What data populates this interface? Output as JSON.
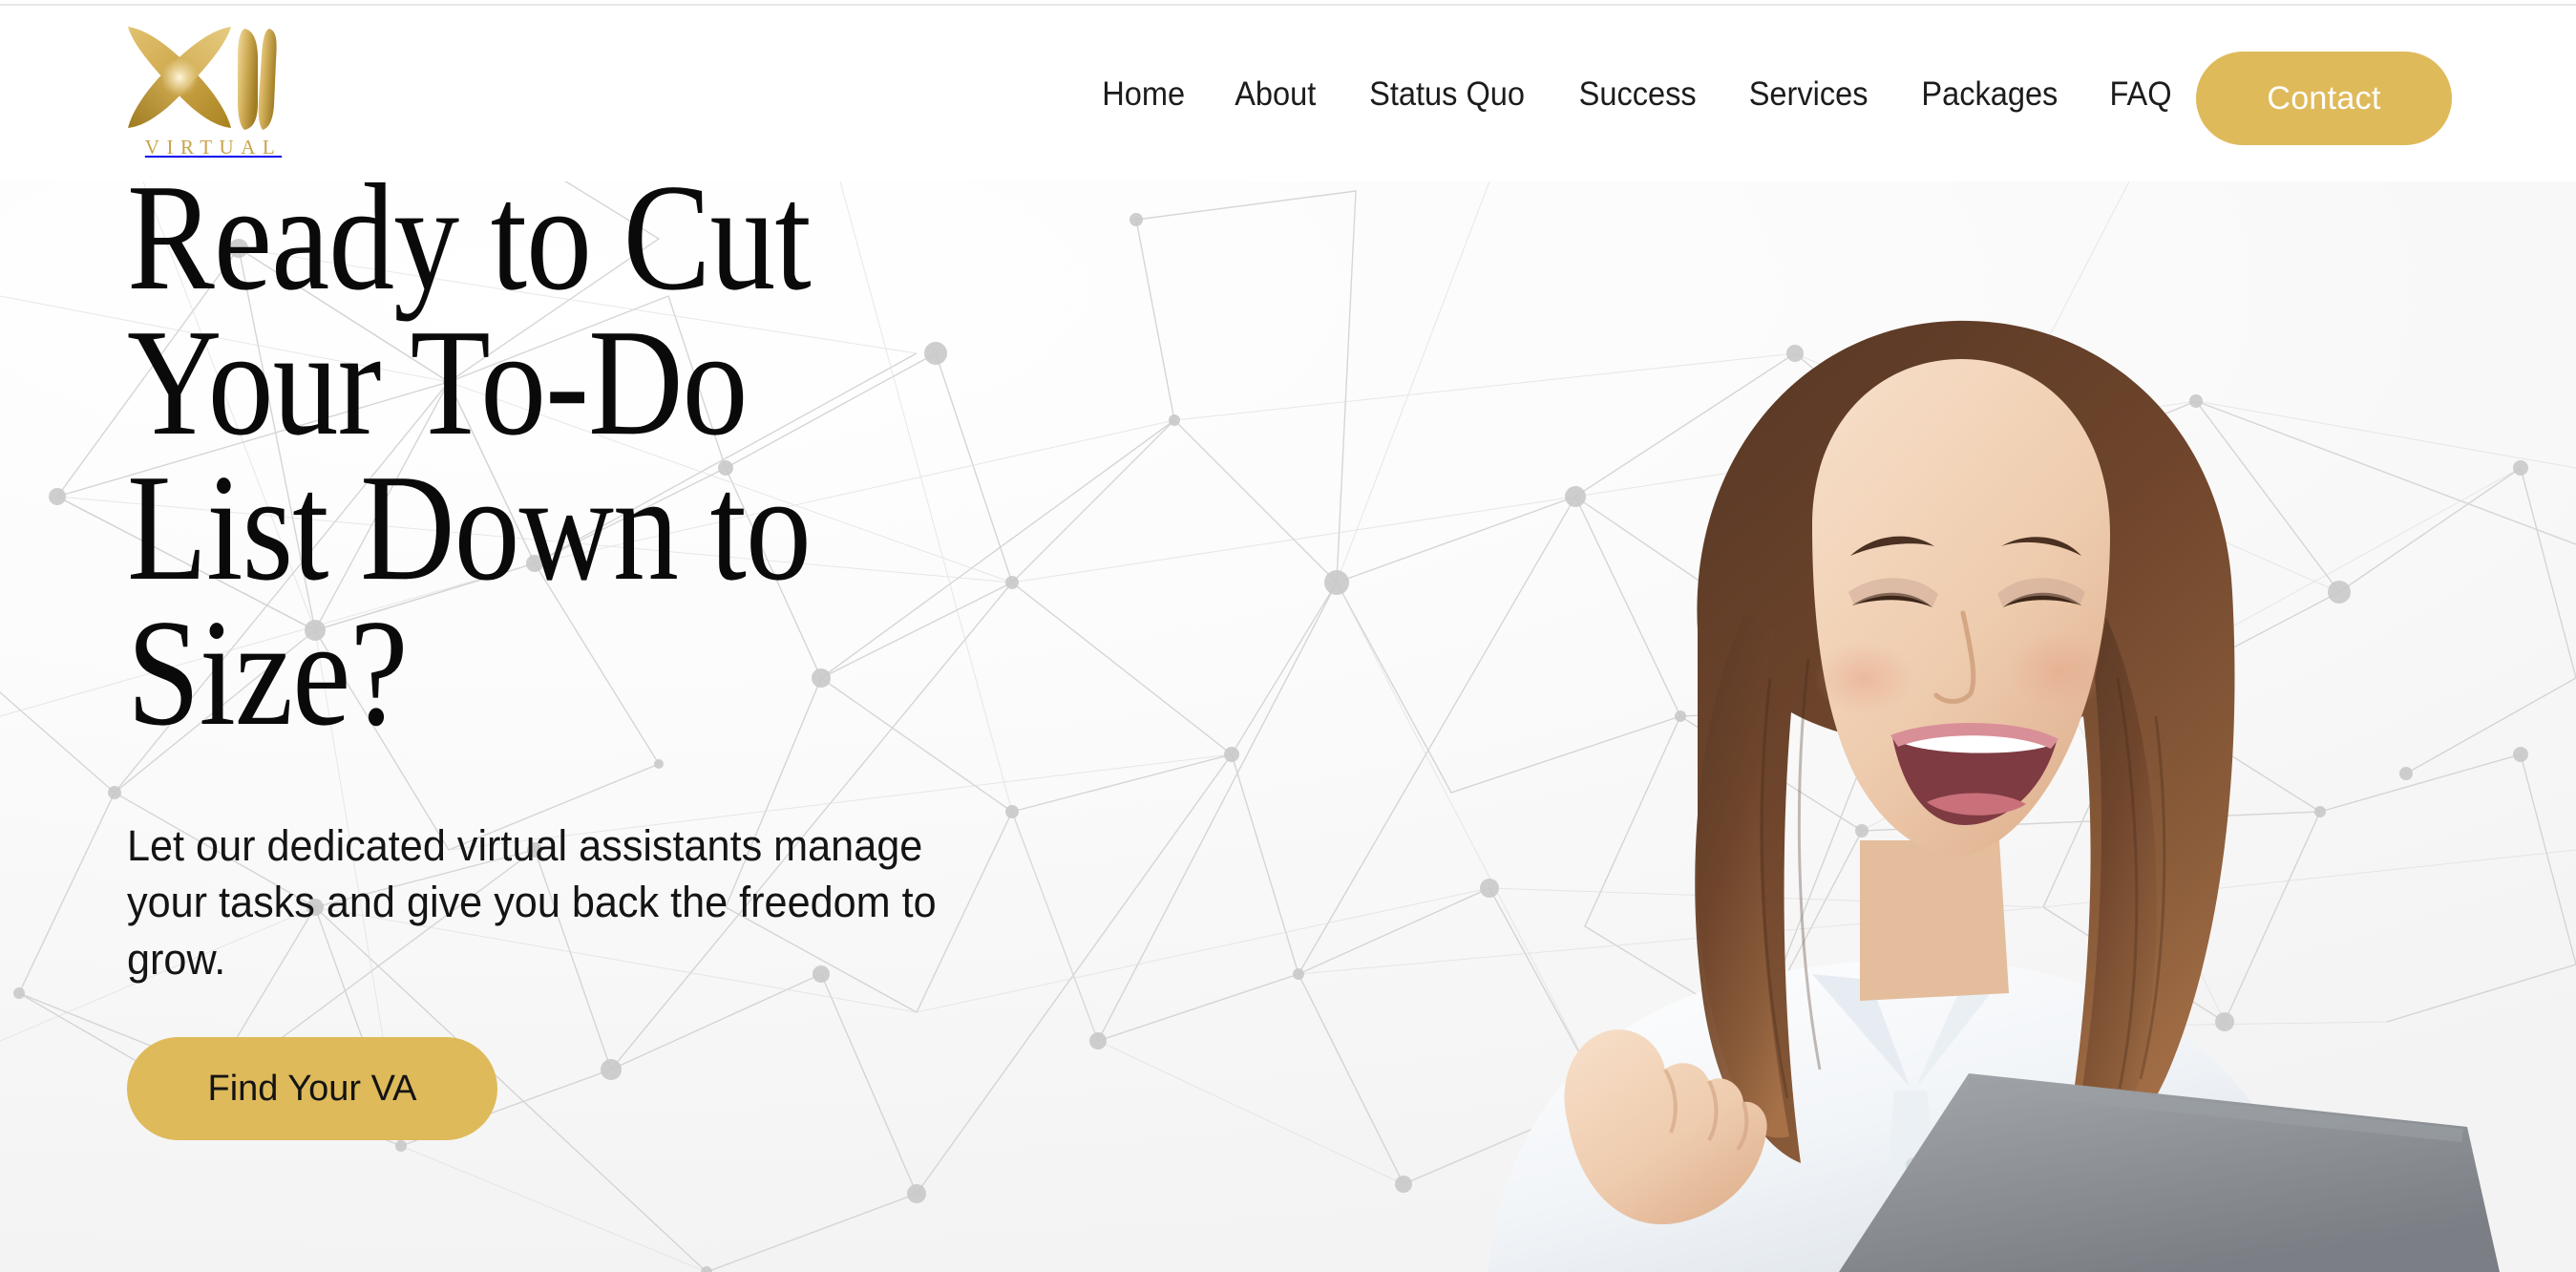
{
  "brand": {
    "logo_icon": "xii-virtual-logo",
    "wordmark": "VIRTUAL",
    "gold": "#DFBA5A",
    "logo_gold_light": "#E8CF85",
    "logo_gold_dark": "#B08A32"
  },
  "nav": {
    "items": [
      {
        "label": "Home"
      },
      {
        "label": "About"
      },
      {
        "label": "Status Quo"
      },
      {
        "label": "Success"
      },
      {
        "label": "Services"
      },
      {
        "label": "Packages"
      },
      {
        "label": "FAQ"
      }
    ],
    "cta": {
      "label": "Contact",
      "bg": "#DFBA5A",
      "text_color": "#FFFFFF"
    }
  },
  "hero": {
    "headline": "Ready to Cut\nYour To-Do\nList Down to\nSize?",
    "subheadline": "Let our dedicated virtual assistants manage your tasks and give you back the freedom to grow.",
    "cta": {
      "label": "Find Your VA",
      "bg": "#DFBA5A",
      "text_color": "#141414"
    },
    "background": {
      "style": "light-gray polygonal network / constellation mesh",
      "base_color": "#FAFAFA",
      "line_color": "#CCCCCC",
      "node_color": "#C8C8C8"
    },
    "image": {
      "alt": "Smiling woman with long brown wavy hair wearing a white button-down shirt, looking down at an open gray laptop",
      "subject": "virtual-assistant-portrait",
      "laptop_color": "#8E9196",
      "shirt_color": "#F4F6F8"
    }
  }
}
